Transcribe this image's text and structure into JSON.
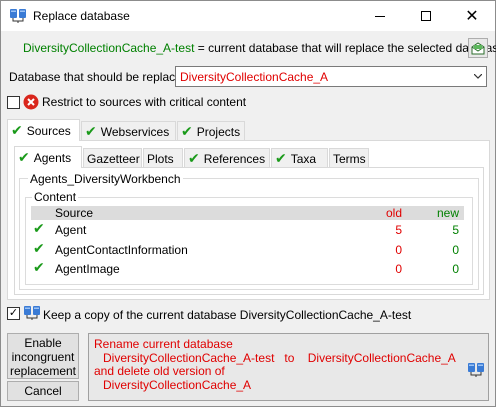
{
  "window": {
    "title": "Replace database"
  },
  "info": {
    "current_db": "DiversityCollectionCache_A-test",
    "description": "= current database that will replace the selected database"
  },
  "replace": {
    "label": "Database that should be replaced:",
    "selected": "DiversityCollectionCache_A"
  },
  "restrict": {
    "checked": false,
    "label": "Restrict to sources with critical content"
  },
  "outer_tabs": [
    {
      "label": "Sources",
      "checked": true,
      "active": true
    },
    {
      "label": "Webservices",
      "checked": true,
      "active": false
    },
    {
      "label": "Projects",
      "checked": true,
      "active": false
    }
  ],
  "inner_tabs": [
    {
      "label": "Agents",
      "checked": true,
      "active": true
    },
    {
      "label": "Gazetteer",
      "checked": false,
      "active": false
    },
    {
      "label": "Plots",
      "checked": false,
      "active": false
    },
    {
      "label": "References",
      "checked": true,
      "active": false
    },
    {
      "label": "Taxa",
      "checked": true,
      "active": false
    },
    {
      "label": "Terms",
      "checked": false,
      "active": false
    }
  ],
  "panel": {
    "group_title": "Agents_DiversityWorkbench",
    "content_title": "Content",
    "columns": {
      "source": "Source",
      "old": "old",
      "new": "new"
    },
    "rows": [
      {
        "source": "Agent",
        "old": "5",
        "new": "5"
      },
      {
        "source": "AgentContactInformation",
        "old": "0",
        "new": "0"
      },
      {
        "source": "AgentImage",
        "old": "0",
        "new": "0"
      }
    ]
  },
  "keep": {
    "checked": true,
    "label": "Keep a copy of the current database DiversityCollectionCache_A-test"
  },
  "buttons": {
    "enable": [
      "Enable",
      "incongruent",
      "replacement"
    ],
    "cancel": "Cancel"
  },
  "rename": {
    "lines": [
      "Rename current database",
      "DiversityCollectionCache_A-test   to    DiversityCollectionCache_A",
      "and delete old version of",
      "DiversityCollectionCache_A"
    ]
  },
  "icons": {
    "app": "database-connect-icon",
    "restrict": "error-x-icon",
    "mail": "mail-icon",
    "check": "green-check-icon"
  },
  "colors": {
    "accent_green": "#008000",
    "alert_red": "#e00000",
    "check_green": "#1a9a1a"
  }
}
